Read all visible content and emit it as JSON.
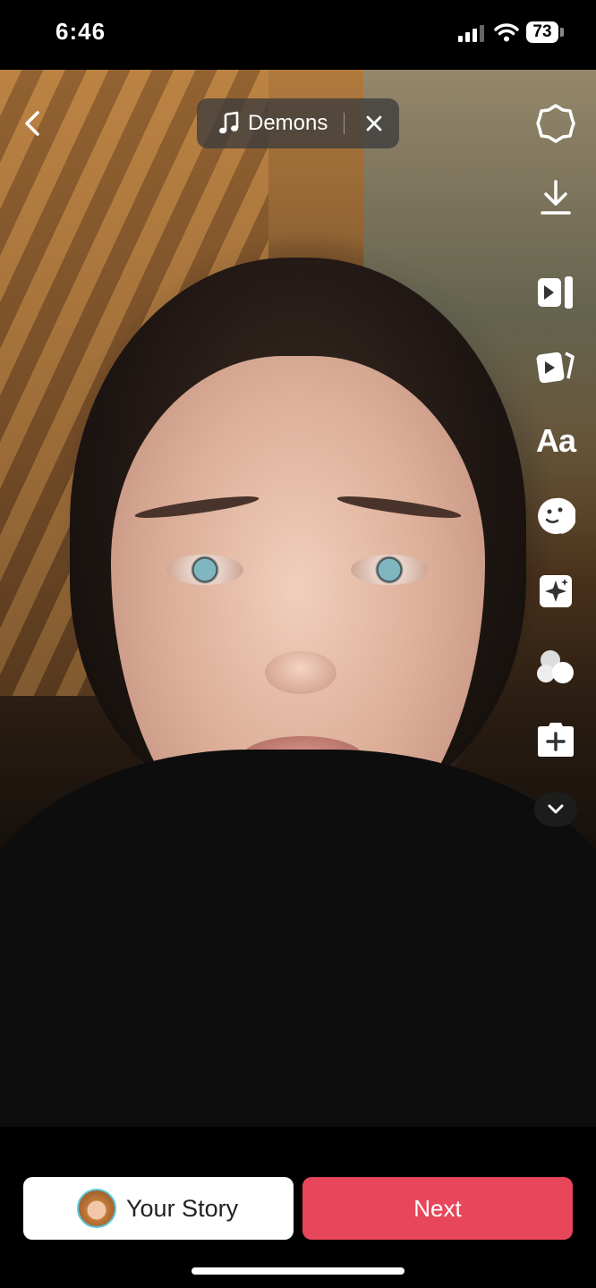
{
  "status_bar": {
    "time": "6:46",
    "battery": "73"
  },
  "editor": {
    "sound": {
      "title": "Demons"
    },
    "side_tools": [
      "settings-icon",
      "download-icon",
      "clip-edit-icon",
      "templates-icon",
      "text-icon",
      "stickers-icon",
      "effects-icon",
      "filters-icon",
      "add-media-icon"
    ],
    "text_tool_label": "Aa"
  },
  "bottom_bar": {
    "story_label": "Your Story",
    "next_label": "Next"
  },
  "colors": {
    "next_button": "#e8465a",
    "story_button": "#ffffff",
    "avatar_ring": "#5bc8d8"
  }
}
